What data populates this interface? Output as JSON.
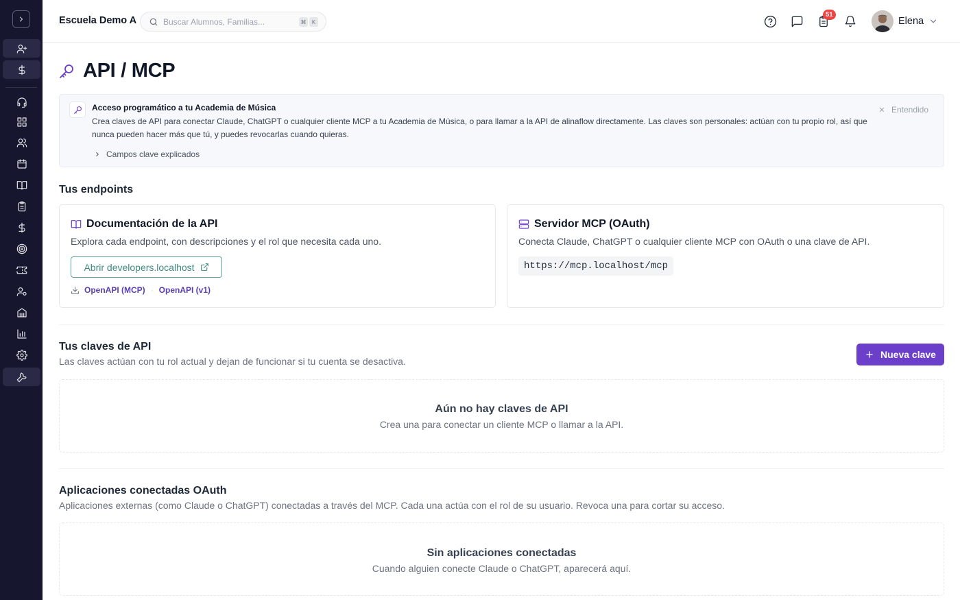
{
  "topbar": {
    "school_name": "Escuela Demo A",
    "search_placeholder": "Buscar Alumnos, Familias...",
    "search_shortcut": [
      "⌘",
      "K"
    ],
    "notification_count": "51",
    "user_name": "Elena"
  },
  "page": {
    "title": "API / MCP"
  },
  "info_banner": {
    "title": "Acceso programático a tu Academia de Música",
    "body": "Crea claves de API para conectar Claude, ChatGPT o cualquier cliente MCP a tu Academia de Música, o para llamar a la API de alinaflow directamente. Las claves son personales: actúan con tu propio rol, así que nunca pueden hacer más que tú, y puedes revocarlas cuando quieras.",
    "details_link": "Campos clave explicados",
    "dismiss_label": "Entendido"
  },
  "endpoints": {
    "heading": "Tus endpoints",
    "api_docs": {
      "title": "Documentación de la API",
      "description": "Explora cada endpoint, con descripciones y el rol que necesita cada uno.",
      "button_label": "Abrir developers.localhost",
      "openapi_mcp": "OpenAPI (MCP)",
      "openapi_v1": "OpenAPI (v1)"
    },
    "mcp_server": {
      "title": "Servidor MCP (OAuth)",
      "description": "Conecta Claude, ChatGPT o cualquier cliente MCP con OAuth o una clave de API.",
      "url": "https://mcp.localhost/mcp"
    }
  },
  "api_keys": {
    "heading": "Tus claves de API",
    "subheading": "Las claves actúan con tu rol actual y dejan de funcionar si tu cuenta se desactiva.",
    "new_key_label": "Nueva clave",
    "empty_title": "Aún no hay claves de API",
    "empty_subtitle": "Crea una para conectar un cliente MCP o llamar a la API."
  },
  "oauth_apps": {
    "heading": "Aplicaciones conectadas OAuth",
    "subheading": "Aplicaciones externas (como Claude o ChatGPT) conectadas a través del MCP. Cada una actúa con el rol de su usuario. Revoca una para cortar su acceso.",
    "empty_title": "Sin aplicaciones conectadas",
    "empty_subtitle": "Cuando alguien conecte Claude o ChatGPT, aparecerá aquí."
  },
  "colors": {
    "sidebar_bg": "#16162e",
    "primary": "#6b3fc9",
    "accent_link": "#5b3fb0",
    "teal_button": "#3f8a80",
    "badge": "#ef4444"
  },
  "sidebar_icons": [
    "user-plus-icon",
    "dollar-icon",
    "headset-icon",
    "grid-icon",
    "users-icon",
    "calendar-icon",
    "book-icon",
    "clipboard-icon",
    "dollar-icon",
    "target-icon",
    "ticket-icon",
    "user-gear-icon",
    "building-icon",
    "bar-chart-icon",
    "gear-icon",
    "wrench-icon"
  ]
}
